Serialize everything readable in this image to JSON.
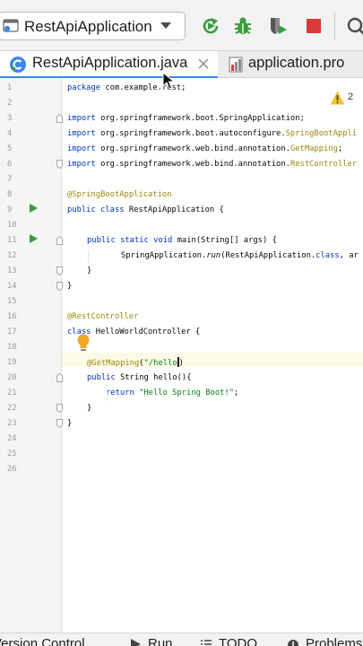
{
  "toolbar": {
    "run_config_label": "RestApiApplication",
    "icons": [
      "rerun-icon",
      "debug-icon",
      "coverage-icon",
      "stop-icon",
      "search-icon"
    ],
    "colors": {
      "run": "#3a9b3a",
      "stop": "#db3b36"
    }
  },
  "tabs": [
    {
      "label": "RestApiApplication.java",
      "icon": "java-class-icon",
      "active": true
    },
    {
      "label": "application.pro",
      "icon": "properties-file-icon",
      "active": false
    }
  ],
  "editor": {
    "warnings": "2",
    "line_numbers": [
      "1",
      "2",
      "3",
      "4",
      "5",
      "6",
      "7",
      "8",
      "9",
      "10",
      "11",
      "12",
      "13",
      "14",
      "15",
      "16",
      "17",
      "18",
      "19",
      "20",
      "21",
      "22",
      "23",
      "24",
      "25",
      "26"
    ],
    "lines": {
      "l1": {
        "kw": "package",
        "rest": " com.example.rest;"
      },
      "l3": {
        "kw": "import",
        "rest": " org.springframework.boot.SpringApplication;"
      },
      "l4": {
        "kw": "import",
        "rest": " org.springframework.boot.autoconfigure.",
        "ann": "SpringBootAppli"
      },
      "l5": {
        "kw": "import",
        "rest": " org.springframework.web.bind.annotation.",
        "ann": "GetMapping",
        "tail": ";"
      },
      "l6": {
        "kw": "import",
        "rest": " org.springframework.web.bind.annotation.",
        "ann": "RestController"
      },
      "l8": {
        "ann": "@SpringBootApplication"
      },
      "l9": {
        "kw": "public class",
        "rest": " RestApiApplication {"
      },
      "l11": {
        "kw": "public static void",
        "rest": " main(String[] args) {"
      },
      "l12": {
        "rest": "SpringApplication.",
        "ital": "run",
        "rest2": "(RestApiApplication.",
        "kw": "class",
        "rest3": ", ar"
      },
      "l13": {
        "rest": "}"
      },
      "l14": {
        "rest": "}"
      },
      "l16": {
        "ann": "@RestController"
      },
      "l17": {
        "kw": "class",
        "rest": " HelloWorldController {"
      },
      "l19": {
        "ann": "@GetMapping",
        "rest": "(",
        "str": "\"/hello",
        "rest2": ")"
      },
      "l20": {
        "kw": "public",
        "rest": " String hello(){"
      },
      "l21": {
        "kw": "return",
        "str": " \"Hello Spring Boot!\"",
        "rest": ";"
      },
      "l22": {
        "rest": "}"
      },
      "l23": {
        "rest": "}"
      }
    }
  },
  "bottom": {
    "version_control": "Version Control",
    "run": "Run",
    "todo": "TODO",
    "problems": "Problems"
  }
}
